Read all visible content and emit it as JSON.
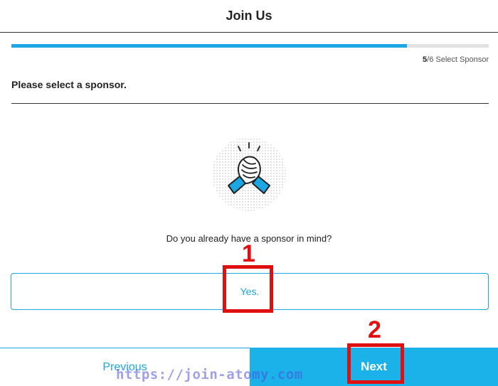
{
  "header": {
    "title": "Join Us"
  },
  "progress": {
    "current": "5",
    "total": "/6",
    "label": "Select Sponsor",
    "fraction": 0.829
  },
  "section": {
    "title": "Please select a sponsor."
  },
  "illustration": {
    "icon": "handshake-icon"
  },
  "question": {
    "text": "Do you already have a sponsor in mind?"
  },
  "options": {
    "yes_label": "Yes."
  },
  "footer": {
    "previous_label": "Previous",
    "next_label": "Next"
  },
  "annotations": {
    "callout_1": "1",
    "callout_2": "2"
  },
  "watermark": {
    "text": "https://join-atomy.com"
  },
  "colors": {
    "accent": "#1aa7e3",
    "next_bg": "#1ab2e8",
    "callout": "#e01010"
  }
}
